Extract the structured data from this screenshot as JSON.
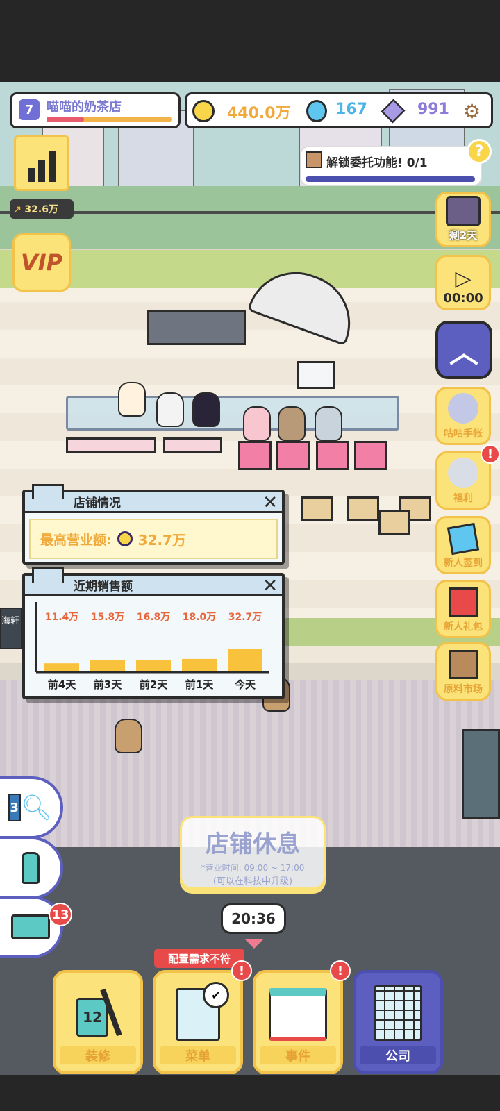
{
  "header": {
    "level": "7",
    "shop_name": "喵喵的奶茶店",
    "coins": "440.0万",
    "gems_blue": "167",
    "gems_purple": "991"
  },
  "stats": {
    "income_rate": "32.6万",
    "vip": "VIP"
  },
  "quest": {
    "text": "解锁委托功能!",
    "progress": "0/1"
  },
  "side_buttons": {
    "countdown_days": "剩2天",
    "timer": "00:00",
    "notebook": "咕咕手帐",
    "welfare": "福利",
    "signin": "新人签到",
    "gift": "新人礼包",
    "market": "原料市场"
  },
  "store_window": {
    "title": "店铺情况",
    "best_label": "最高营业额:",
    "best_value": "32.7万"
  },
  "sales_window": {
    "title": "近期销售额"
  },
  "chart_data": {
    "type": "bar",
    "categories": [
      "前4天",
      "前3天",
      "前2天",
      "前1天",
      "今天"
    ],
    "values": [
      11.4,
      15.8,
      16.8,
      18.0,
      32.7
    ],
    "value_labels": [
      "11.4万",
      "15.8万",
      "16.8万",
      "18.0万",
      "32.7万"
    ],
    "ylim": [
      0,
      100
    ],
    "bar_color": "#f9c23c",
    "label_color": "#e8663b"
  },
  "sign": {
    "partial": "海轩"
  },
  "closed": {
    "title": "店铺休息",
    "hours": "*营业时间: 09:00 ~ 17:00",
    "note": "(可以在科技中升级)"
  },
  "clock": "20:36",
  "warning": "配置需求不符",
  "left_tools": {
    "search_count": "3",
    "box_badge": "13"
  },
  "nav": {
    "decorate": "装修",
    "decorate_count": "12",
    "menu": "菜单",
    "events": "事件",
    "company": "公司",
    "alert": "!"
  },
  "colors": {
    "accent_yellow": "#fbe27a",
    "accent_purple": "#5c5fbf",
    "warning_red": "#e84a4a",
    "coin_text": "#f0a93a",
    "gem_blue_text": "#4cb5e8",
    "gem_purple_text": "#8e7ad8"
  }
}
